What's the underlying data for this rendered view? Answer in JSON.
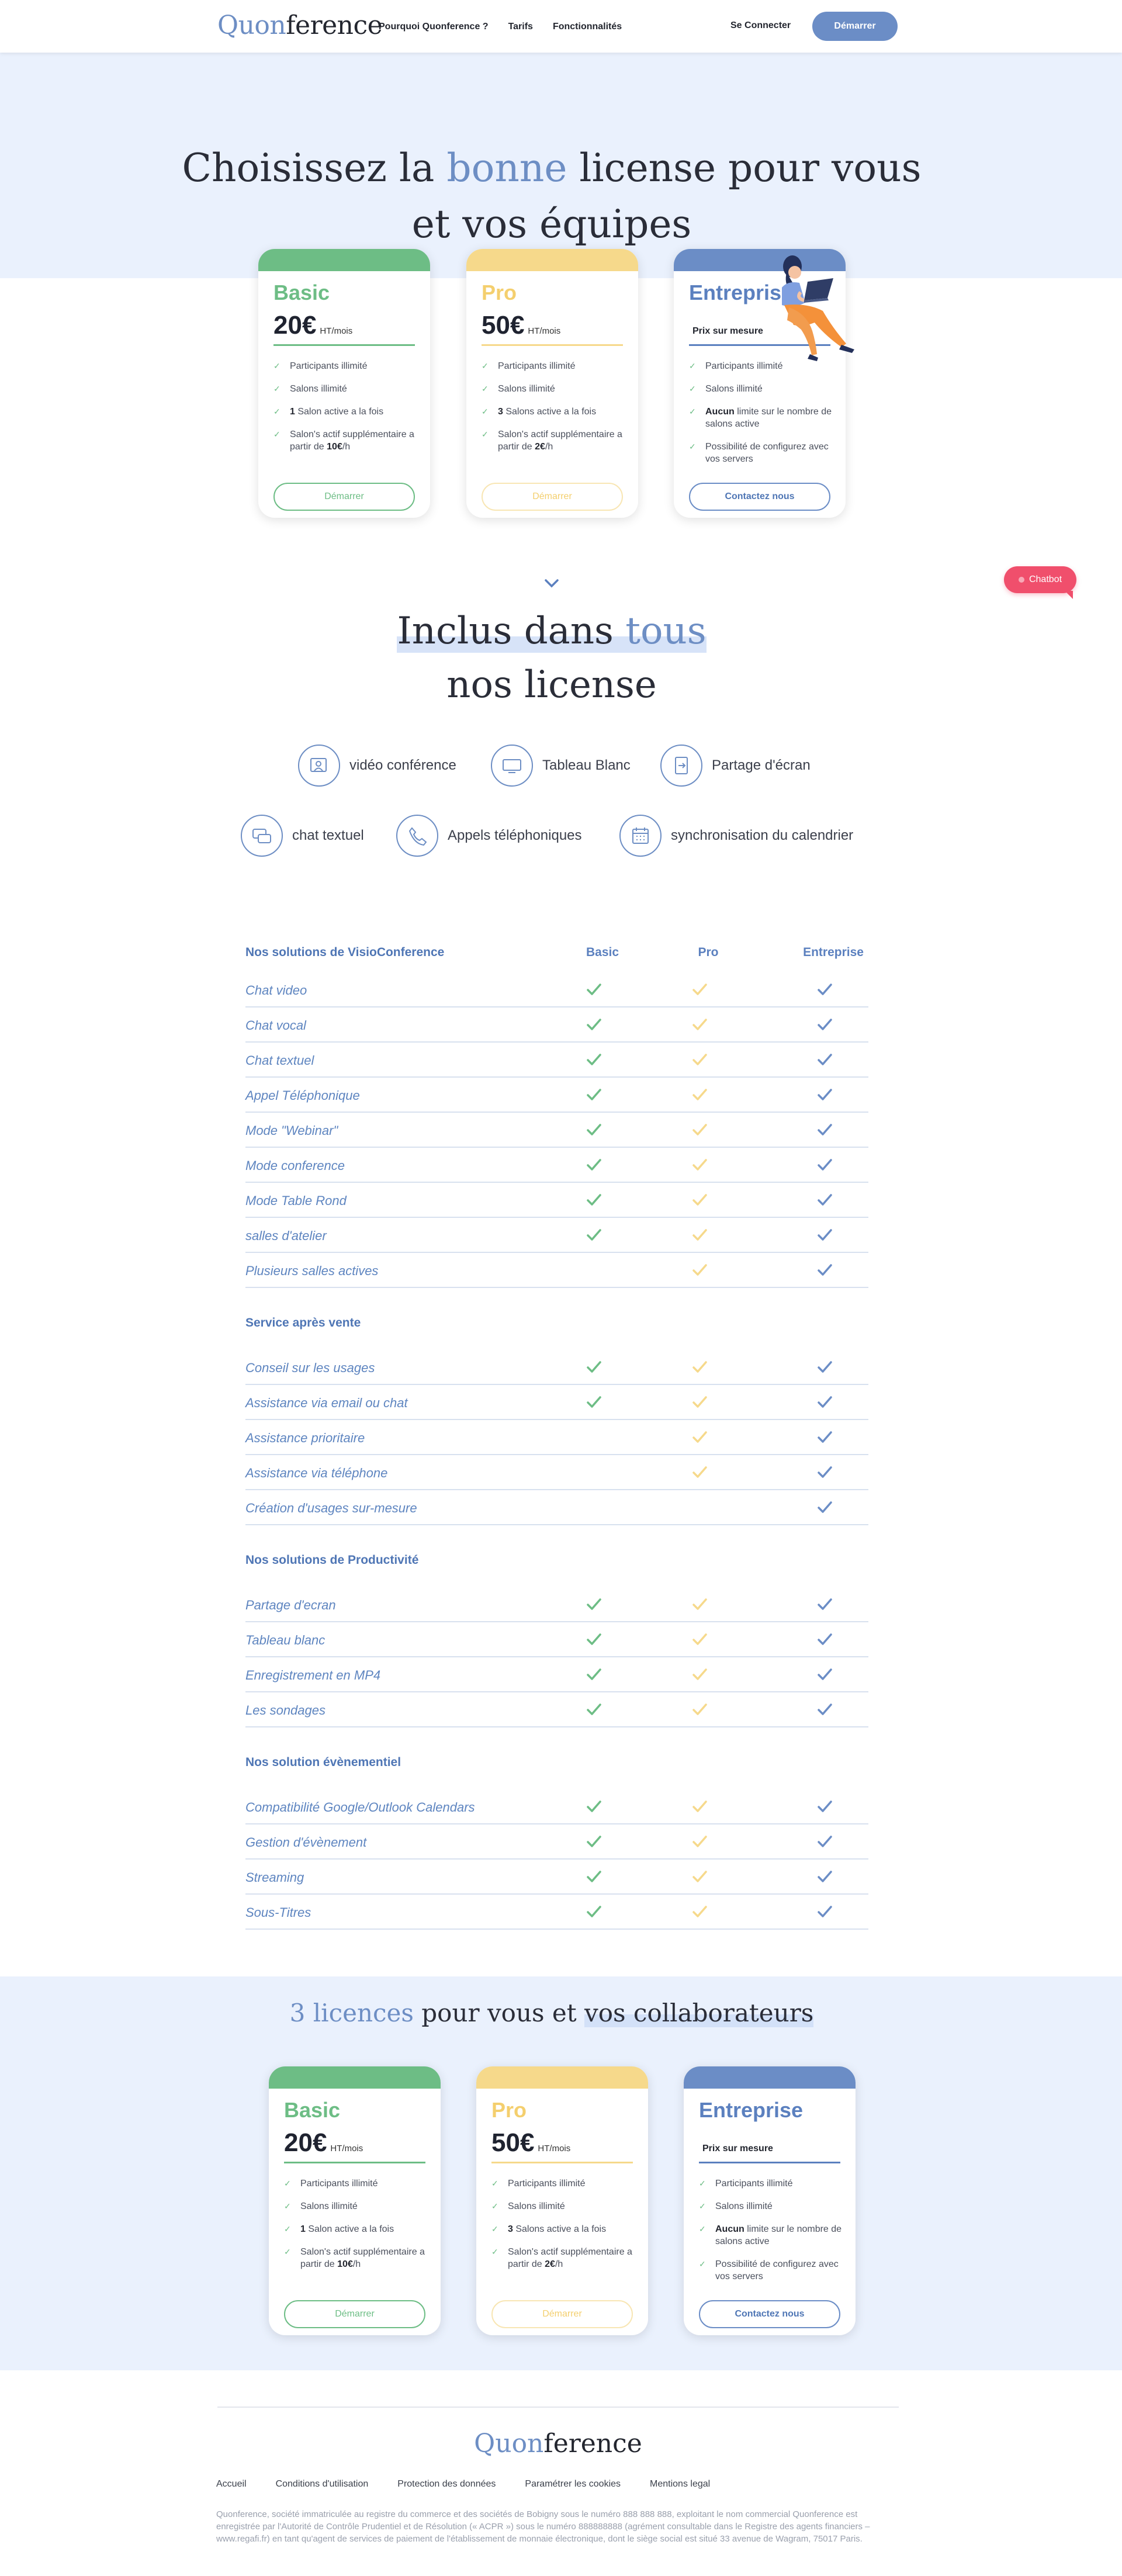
{
  "nav": {
    "logo_accent": "Quon",
    "logo_rest": "ference",
    "links": [
      "Pourquoi Quonference ?",
      "Tarifs",
      "Fonctionnalités"
    ],
    "login": "Se Connecter",
    "start": "Démarrer"
  },
  "hero": {
    "title_pre": "Choisissez la ",
    "title_accent": "bonne",
    "title_post": " license pour vous",
    "title_line2": "et vos équipes"
  },
  "colors": {
    "basic": "#6dbd85",
    "pro": "#f6d98b",
    "enterprise": "#6b8dc6",
    "accent": "#6d8ec4",
    "chatbot": "#f04f6c"
  },
  "plans": [
    {
      "name": "Basic",
      "price": "20€",
      "unit": "HT/mois",
      "features": [
        {
          "text": "Participants illimité"
        },
        {
          "text": "Salons illimité"
        },
        {
          "bold": "1",
          "text": " Salon active a la fois"
        },
        {
          "text": "Salon's actif supplémentaire a partir de ",
          "bold2": "10€",
          "text2": "/h"
        }
      ],
      "cta": "Démarrer"
    },
    {
      "name": "Pro",
      "price": "50€",
      "unit": "HT/mois",
      "features": [
        {
          "text": "Participants illimité"
        },
        {
          "text": "Salons illimité"
        },
        {
          "bold": "3",
          "text": " Salons active a la fois"
        },
        {
          "text": "Salon's actif supplémentaire a partir de ",
          "bold2": "2€",
          "text2": "/h"
        }
      ],
      "cta": "Démarrer"
    },
    {
      "name": "Entreprise",
      "custom": "Prix sur mesure",
      "features": [
        {
          "text": "Participants illimité"
        },
        {
          "text": "Salons illimité"
        },
        {
          "bold": "Aucun",
          "text": " limite sur le nombre de salons active"
        },
        {
          "text": "Possibilité de configurez avec vos servers"
        }
      ],
      "cta": "Contactez nous"
    }
  ],
  "chatbot": "Chatbot",
  "inclus": {
    "title_hl": "Inclus dans ",
    "title_accent": "tous",
    "title_line2": "nos license",
    "features": [
      {
        "label": "vidéo conférence",
        "icon": "video-conference-icon"
      },
      {
        "label": "Tableau Blanc",
        "icon": "whiteboard-icon"
      },
      {
        "label": "Partage d'écran",
        "icon": "screen-share-icon"
      },
      {
        "label": "chat textuel",
        "icon": "chat-icon"
      },
      {
        "label": "Appels téléphoniques",
        "icon": "phone-icon"
      },
      {
        "label": "synchronisation du calendrier",
        "icon": "calendar-icon"
      }
    ]
  },
  "table": {
    "columns": [
      "Basic",
      "Pro",
      "Entreprise"
    ],
    "sections": [
      {
        "title": "Nos solutions de VisioConference",
        "rows": [
          {
            "label": "Chat video",
            "basic": true,
            "pro": true,
            "ent": true
          },
          {
            "label": "Chat vocal",
            "basic": true,
            "pro": true,
            "ent": true
          },
          {
            "label": "Chat textuel",
            "basic": true,
            "pro": true,
            "ent": true
          },
          {
            "label": "Appel Téléphonique",
            "basic": true,
            "pro": true,
            "ent": true
          },
          {
            "label": "Mode \"Webinar\"",
            "basic": true,
            "pro": true,
            "ent": true
          },
          {
            "label": "Mode conference",
            "basic": true,
            "pro": true,
            "ent": true
          },
          {
            "label": "Mode Table Rond",
            "basic": true,
            "pro": true,
            "ent": true
          },
          {
            "label": "salles d'atelier",
            "basic": true,
            "pro": true,
            "ent": true
          },
          {
            "label": "Plusieurs salles actives",
            "basic": false,
            "pro": true,
            "ent": true
          }
        ]
      },
      {
        "title": "Service après vente",
        "rows": [
          {
            "label": "Conseil sur les usages",
            "basic": true,
            "pro": true,
            "ent": true
          },
          {
            "label": "Assistance via email ou chat",
            "basic": true,
            "pro": true,
            "ent": true
          },
          {
            "label": "Assistance prioritaire",
            "basic": false,
            "pro": true,
            "ent": true
          },
          {
            "label": "Assistance via téléphone",
            "basic": false,
            "pro": true,
            "ent": true
          },
          {
            "label": "Création d'usages sur-mesure",
            "basic": false,
            "pro": false,
            "ent": true
          }
        ]
      },
      {
        "title": "Nos solutions de Productivité",
        "rows": [
          {
            "label": "Partage d'ecran",
            "basic": true,
            "pro": true,
            "ent": true
          },
          {
            "label": "Tableau blanc",
            "basic": true,
            "pro": true,
            "ent": true
          },
          {
            "label": "Enregistrement en MP4",
            "basic": true,
            "pro": true,
            "ent": true
          },
          {
            "label": "Les sondages",
            "basic": true,
            "pro": true,
            "ent": true
          }
        ]
      },
      {
        "title": "Nos solution évènementiel",
        "rows": [
          {
            "label": "Compatibilité Google/Outlook Calendars",
            "basic": true,
            "pro": true,
            "ent": true
          },
          {
            "label": "Gestion d'évènement",
            "basic": true,
            "pro": true,
            "ent": true
          },
          {
            "label": "Streaming",
            "basic": true,
            "pro": true,
            "ent": true
          },
          {
            "label": "Sous-Titres",
            "basic": true,
            "pro": true,
            "ent": true
          }
        ]
      }
    ]
  },
  "licences": {
    "title_accent": "3 licences",
    "title_mid": " pour vous et ",
    "title_hl": "vos collaborateurs"
  },
  "footer": {
    "logo_accent": "Quon",
    "logo_rest": "ference",
    "links": [
      "Accueil",
      "Conditions d'utilisation",
      "Protection des données",
      "Paramétrer les cookies",
      "Mentions legal"
    ],
    "legal": "Quonference, société immatriculée au registre du commerce et des sociétés de Bobigny sous le numéro 888 888 888, exploitant le nom commercial Quonference est enregistrée par l'Autorité de Contrôle Prudentiel et de Résolution (« ACPR ») sous le numéro 888888888 (agrément consultable dans le Registre des agents financiers – www.regafi.fr) en tant qu'agent de services de paiement de l'établissement de monnaie électronique, dont le siège social est situé 33 avenue de Wagram, 75017 Paris."
  }
}
